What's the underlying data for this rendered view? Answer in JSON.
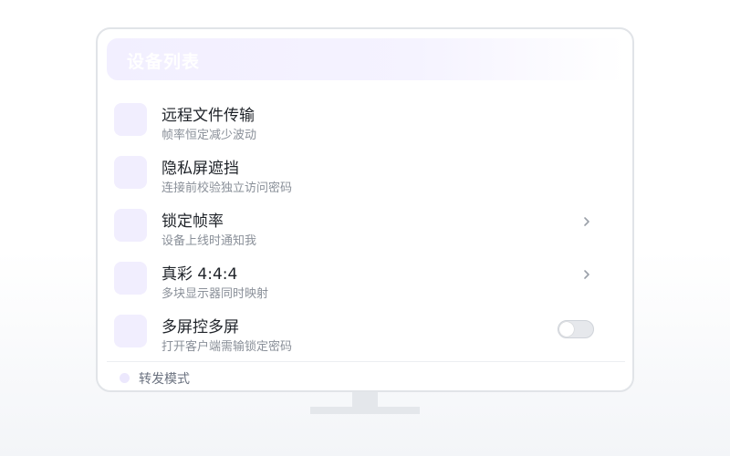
{
  "title": "设备列表",
  "items": [
    {
      "title": "远程文件传输",
      "subtitle": "帧率恒定减少波动",
      "control": "none"
    },
    {
      "title": "隐私屏遮挡",
      "subtitle": "连接前校验独立访问密码",
      "control": "none"
    },
    {
      "title": "锁定帧率",
      "subtitle": "设备上线时通知我",
      "control": "chevron-right-icon"
    },
    {
      "title": "真彩 4:4:4",
      "subtitle": "多块显示器同时映射",
      "control": "chevron-right-icon"
    },
    {
      "title": "多屏控多屏",
      "subtitle": "打开客户端需输锁定密码",
      "control": "toggle",
      "toggle_on": false
    }
  ],
  "footer": {
    "label": "转发模式"
  },
  "colors": {
    "accent_soft": "#f1eefe",
    "border": "#e1e4e8",
    "title_text": "#1f2329",
    "subtitle_text": "#8a9099"
  }
}
